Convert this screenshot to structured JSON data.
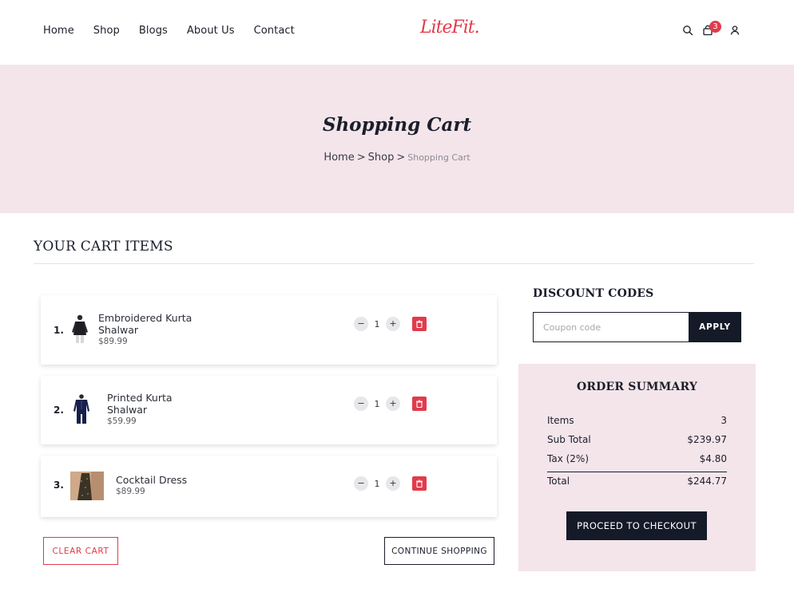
{
  "nav": {
    "items": [
      "Home",
      "Shop",
      "Blogs",
      "About Us",
      "Contact"
    ]
  },
  "logo": {
    "text": "LiteFit."
  },
  "header_icons": {
    "search": "search-icon",
    "cart": "shopping-bag-icon",
    "cart_count": "3",
    "account": "user-icon"
  },
  "hero": {
    "title": "Shopping Cart",
    "breadcrumb": [
      "Home",
      "Shop",
      "Shopping Cart"
    ],
    "separator": ">"
  },
  "cart": {
    "title": "YOUR CART ITEMS",
    "items": [
      {
        "index": "1.",
        "name": "Embroidered Kurta Shalwar",
        "price": "$89.99",
        "qty": "1"
      },
      {
        "index": "2.",
        "name": "Printed Kurta Shalwar",
        "price": "$59.99",
        "qty": "1"
      },
      {
        "index": "3.",
        "name": "Cocktail Dress",
        "price": "$89.99",
        "qty": "1"
      }
    ],
    "minus_label": "−",
    "plus_label": "+",
    "clear_label": "CLEAR CART",
    "continue_label": "CONTINUE SHOPPING"
  },
  "discount": {
    "title": "DISCOUNT CODES",
    "placeholder": "Coupon code",
    "apply_label": "APPLY"
  },
  "summary": {
    "title": "ORDER SUMMARY",
    "rows": [
      {
        "label": "Items",
        "value": "3"
      },
      {
        "label": "Sub Total",
        "value": "$239.97"
      },
      {
        "label": "Tax (2%)",
        "value": "$4.80"
      }
    ],
    "total": {
      "label": "Total",
      "value": "$244.77"
    },
    "checkout_label": "PROCEED TO CHECKOUT"
  },
  "colors": {
    "accent": "#e13b4b",
    "dark": "#151a29",
    "hero_bg": "#f4e5ea"
  }
}
